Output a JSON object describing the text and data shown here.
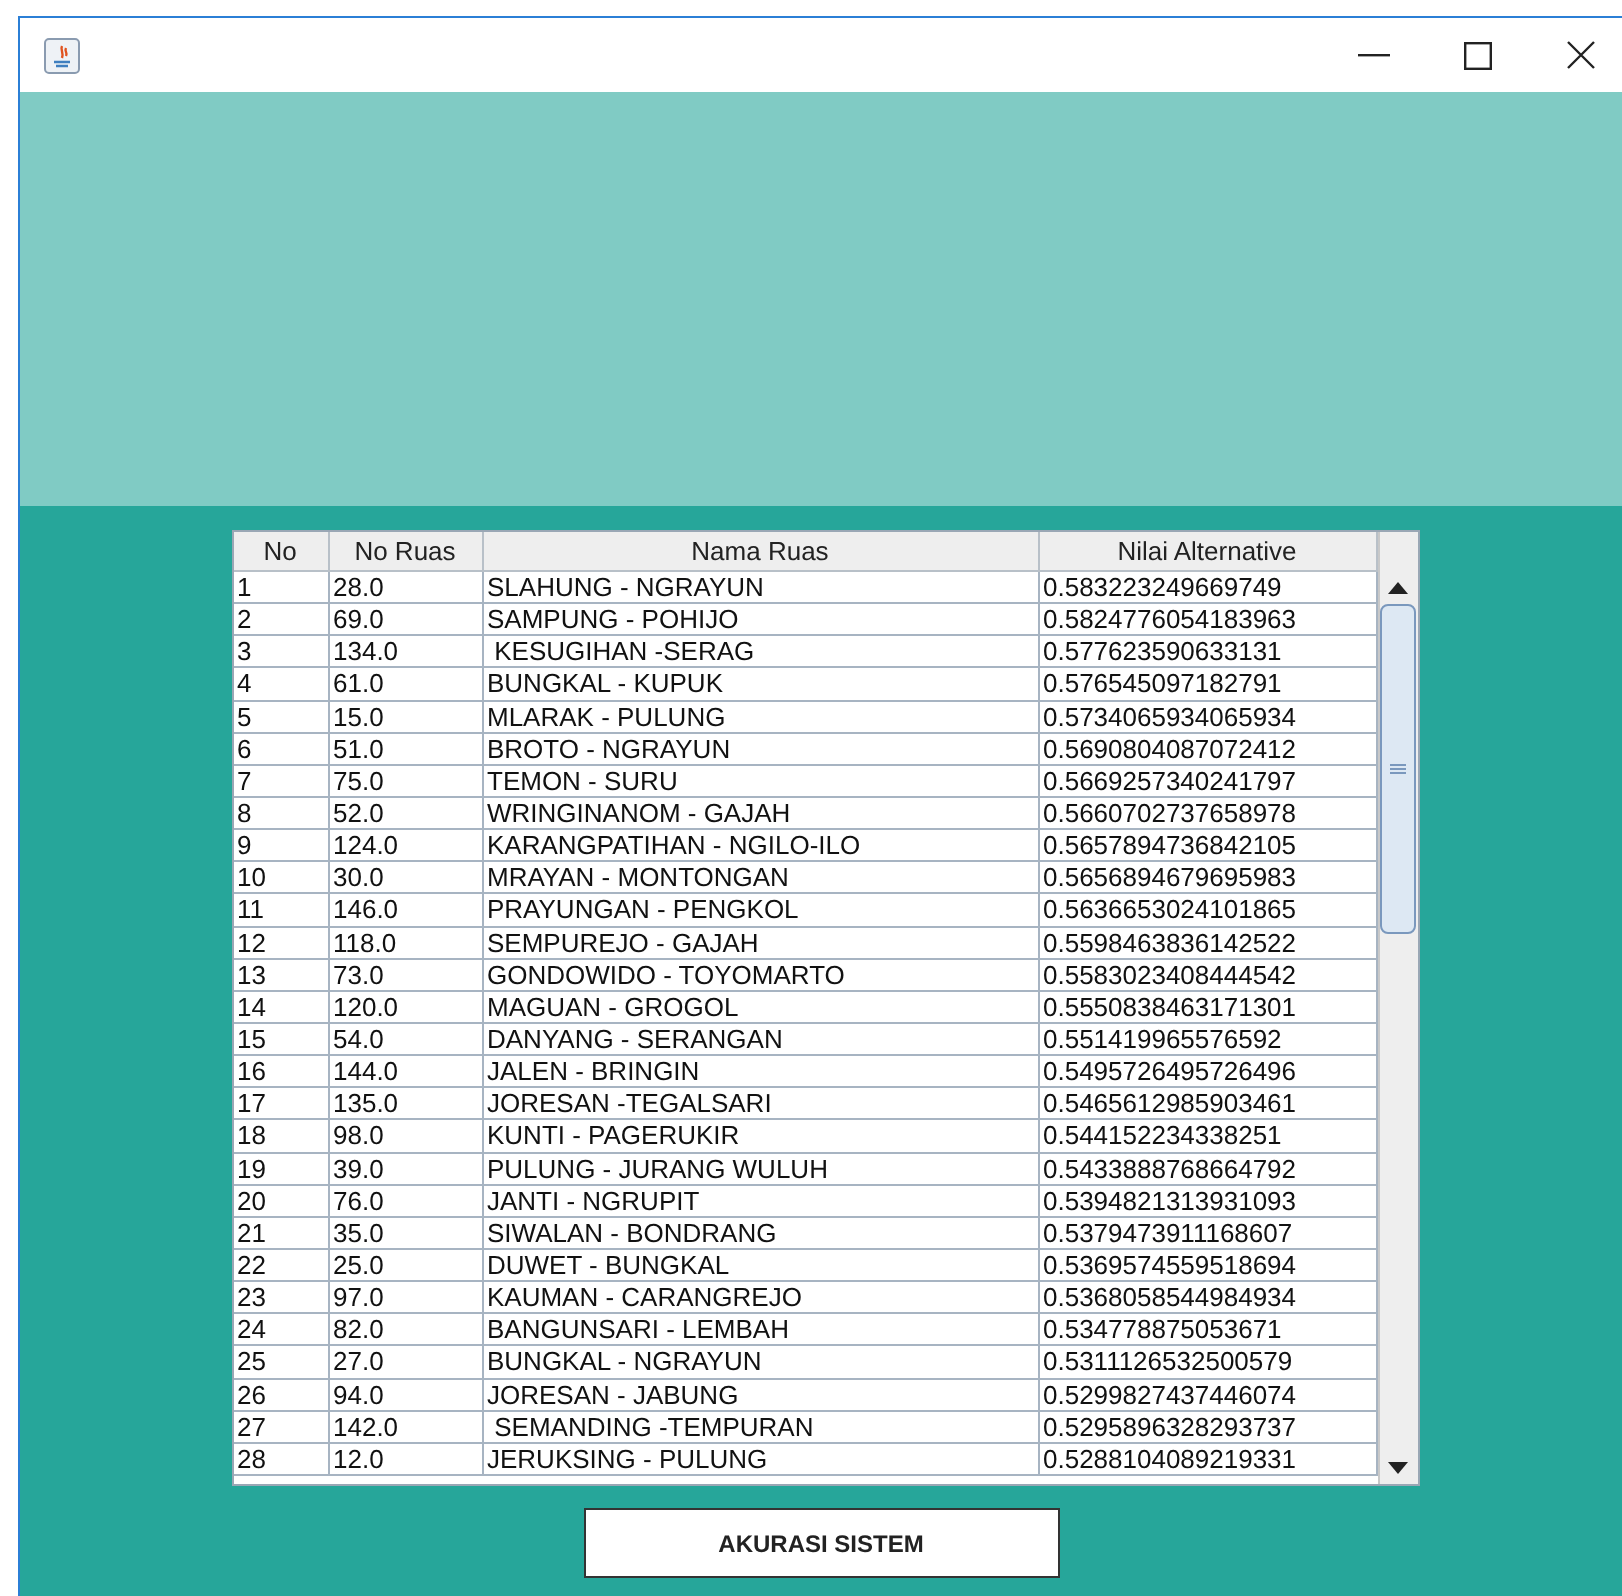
{
  "table": {
    "columns": [
      "No",
      "No Ruas",
      "Nama Ruas",
      "Nilai Alternative"
    ],
    "rows": [
      [
        "1",
        "28.0",
        "SLAHUNG - NGRAYUN",
        "0.583223249669749"
      ],
      [
        "2",
        "69.0",
        "SAMPUNG - POHIJO",
        "0.5824776054183963"
      ],
      [
        "3",
        "134.0",
        " KESUGIHAN -SERAG",
        "0.577623590633131"
      ],
      [
        "4",
        "61.0",
        "BUNGKAL - KUPUK",
        "0.576545097182791"
      ],
      [
        "5",
        "15.0",
        "MLARAK - PULUNG",
        "0.5734065934065934"
      ],
      [
        "6",
        "51.0",
        "BROTO - NGRAYUN",
        "0.5690804087072412"
      ],
      [
        "7",
        "75.0",
        "TEMON - SURU",
        "0.5669257340241797"
      ],
      [
        "8",
        "52.0",
        "WRINGINANOM - GAJAH",
        "0.5660702737658978"
      ],
      [
        "9",
        "124.0",
        "KARANGPATIHAN - NGILO-ILO",
        "0.5657894736842105"
      ],
      [
        "10",
        "30.0",
        "MRAYAN - MONTONGAN",
        "0.5656894679695983"
      ],
      [
        "11",
        "146.0",
        "PRAYUNGAN - PENGKOL",
        "0.5636653024101865"
      ],
      [
        "12",
        "118.0",
        "SEMPUREJO - GAJAH",
        "0.5598463836142522"
      ],
      [
        "13",
        "73.0",
        "GONDOWIDO - TOYOMARTO",
        "0.5583023408444542"
      ],
      [
        "14",
        "120.0",
        "MAGUAN - GROGOL",
        "0.5550838463171301"
      ],
      [
        "15",
        "54.0",
        "DANYANG - SERANGAN",
        "0.551419965576592"
      ],
      [
        "16",
        "144.0",
        "JALEN - BRINGIN",
        "0.5495726495726496"
      ],
      [
        "17",
        "135.0",
        "JORESAN -TEGALSARI",
        "0.5465612985903461"
      ],
      [
        "18",
        "98.0",
        "KUNTI - PAGERUKIR",
        "0.544152234338251"
      ],
      [
        "19",
        "39.0",
        "PULUNG - JURANG WULUH",
        "0.5433888768664792"
      ],
      [
        "20",
        "76.0",
        "JANTI - NGRUPIT",
        "0.5394821313931093"
      ],
      [
        "21",
        "35.0",
        "SIWALAN - BONDRANG",
        "0.5379473911168607"
      ],
      [
        "22",
        "25.0",
        "DUWET - BUNGKAL",
        "0.5369574559518694"
      ],
      [
        "23",
        "97.0",
        "KAUMAN - CARANGREJO",
        "0.5368058544984934"
      ],
      [
        "24",
        "82.0",
        "BANGUNSARI - LEMBAH",
        "0.534778875053671"
      ],
      [
        "25",
        "27.0",
        "BUNGKAL - NGRAYUN",
        "0.5311126532500579"
      ],
      [
        "26",
        "94.0",
        "JORESAN - JABUNG",
        "0.5299827437446074"
      ],
      [
        "27",
        "142.0",
        " SEMANDING -TEMPURAN",
        "0.5295896328293737"
      ],
      [
        "28",
        "12.0",
        "JERUKSING - PULUNG",
        "0.5288104089219331"
      ]
    ]
  },
  "button": {
    "label": "AKURASI SISTEM"
  }
}
